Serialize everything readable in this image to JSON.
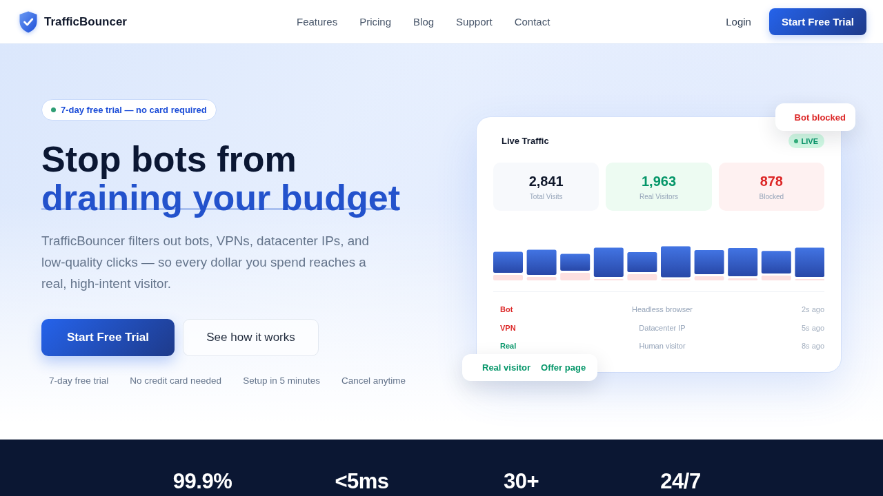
{
  "nav": {
    "brand": "TrafficBouncer",
    "links": [
      "Features",
      "Pricing",
      "Blog",
      "Support",
      "Contact"
    ],
    "login": "Login",
    "cta": "Start Free Trial"
  },
  "hero": {
    "badge": "7-day free trial — no card required",
    "headline": "Stop bots from",
    "headline_highlight": "draining your budget",
    "description": "TrafficBouncer filters out bots, VPNs, datacenter IPs, and low-quality clicks — so every dollar you spend reaches a real, high-intent visitor.",
    "primary_button": "Start Free Trial",
    "secondary_button": "See how it works",
    "perks": [
      "7-day free trial",
      "No credit card needed",
      "Setup in 5 minutes",
      "Cancel anytime"
    ]
  },
  "dashboard": {
    "title": "Live Traffic",
    "status": "LIVE",
    "stats": [
      {
        "kind": "total",
        "value": "2,841",
        "label": "Total Visits"
      },
      {
        "kind": "real",
        "value": "1,963",
        "label": "Real Visitors"
      },
      {
        "kind": "blocked",
        "value": "878",
        "label": "Blocked"
      }
    ],
    "events": [
      {
        "type": "Bot",
        "detail": "Headless browser",
        "time": "2s ago",
        "color": "#dc2626"
      },
      {
        "type": "VPN",
        "detail": "Datacenter IP",
        "time": "5s ago",
        "color": "#dc2626"
      },
      {
        "type": "Real",
        "detail": "Human visitor",
        "time": "8s ago",
        "color": "#059669"
      }
    ],
    "toasts": [
      {
        "kind": "blocked",
        "texts": [
          "Bot blocked"
        ]
      },
      {
        "kind": "allowed",
        "texts": [
          "Real visitor",
          "Offer page"
        ]
      }
    ]
  },
  "stats_band": {
    "values": [
      "99.9%",
      "<5ms",
      "30+",
      "24/7"
    ]
  }
}
